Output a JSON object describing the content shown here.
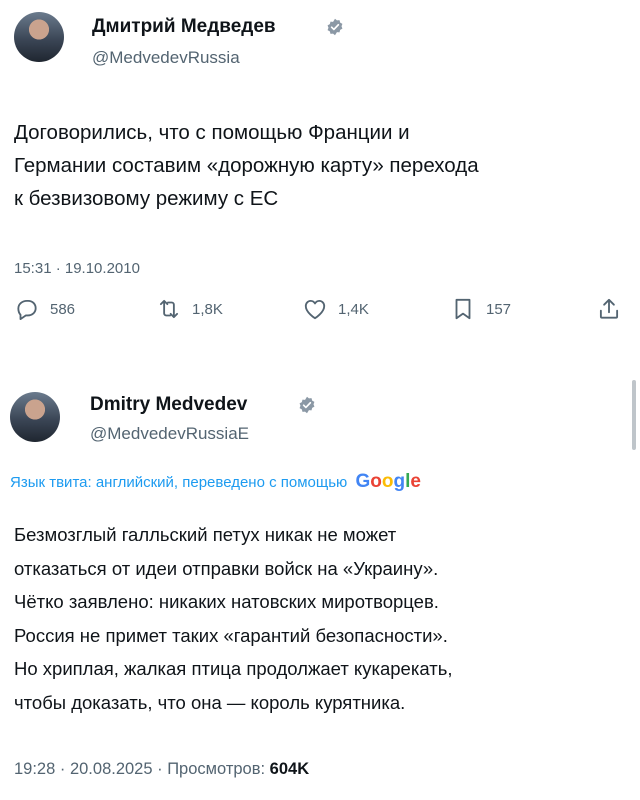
{
  "tweet1": {
    "author_name": "Дмитрий Медведев",
    "handle": "@MedvedevRussia",
    "text_line1": "Договорились, что с помощью Франции и",
    "text_line2": "Германии составим «дорожную карту» перехода",
    "text_line3": "к безвизовому режиму с ЕС",
    "timestamp": "15:31 · 19.10.2010",
    "replies": "586",
    "retweets": "1,8K",
    "likes": "1,4K",
    "bookmarks": "157"
  },
  "tweet2": {
    "author_name": "Dmitry Medvedev",
    "handle": "@MedvedevRussiaE",
    "translation_note": "Язык твита: английский, переведено с помощью",
    "google_letters": [
      "G",
      "o",
      "o",
      "g",
      "l",
      "e"
    ],
    "text_lines": [
      "Безмозглый галльский петух никак не может",
      "отказаться от идеи отправки войск на «Украину».",
      "Чётко заявлено: никаких натовских миротворцев.",
      "Россия не примет таких «гарантий безопасности».",
      "Но хриплая, жалкая птица продолжает кукарекать,",
      "чтобы доказать, что она — король курятника."
    ],
    "timestamp": "19:28 · 20.08.2025 · Просмотров: ",
    "views": "604K"
  },
  "colors": {
    "accent": "#1d9bf0",
    "text": "#0f1419",
    "secondary": "#536471"
  },
  "icons": [
    "verified-badge-icon",
    "reply-icon",
    "retweet-icon",
    "like-icon",
    "bookmark-icon",
    "share-icon"
  ]
}
